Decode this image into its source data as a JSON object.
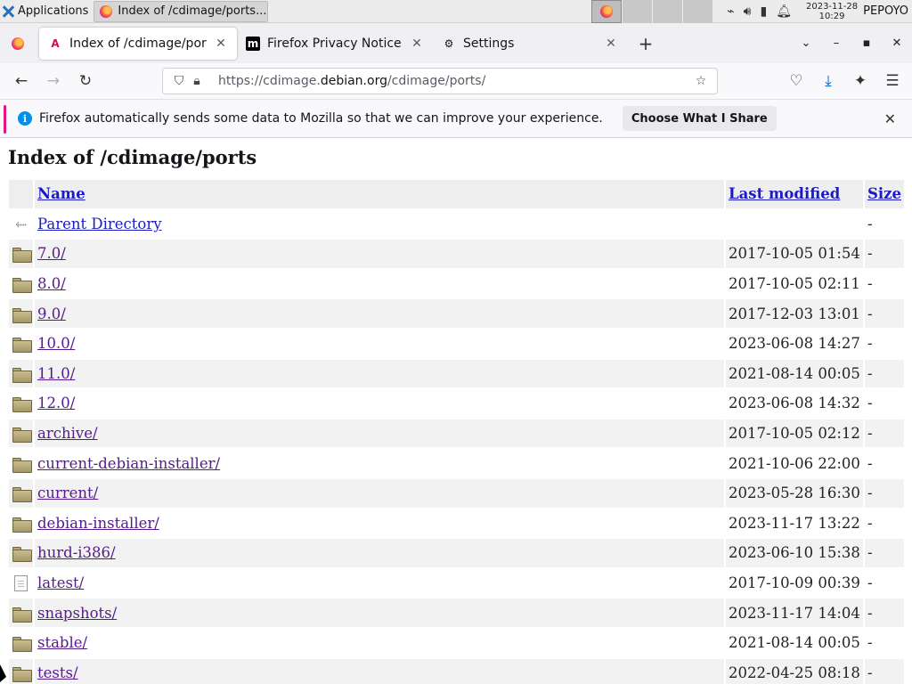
{
  "panel": {
    "apps_label": "Applications",
    "task_title": "Index of /cdimage/ports...",
    "clock_date": "2023-11-28",
    "clock_time": "10:29",
    "user": "PEPOYO"
  },
  "tabs": [
    {
      "title": "Index of /cdimage/ports",
      "icon": "debian-icon",
      "selected": true
    },
    {
      "title": "Firefox Privacy Notice —",
      "icon": "mozilla-icon",
      "selected": false
    },
    {
      "title": "Settings",
      "icon": "gear-icon",
      "selected": false
    }
  ],
  "navbar": {
    "url_prefix": "https://cdimage.",
    "url_domain": "debian.org",
    "url_path": "/cdimage/ports/"
  },
  "notice": {
    "message": "Firefox automatically sends some data to Mozilla so that we can improve your experience.",
    "button": "Choose What I Share"
  },
  "page": {
    "title": "Index of /cdimage/ports",
    "columns": {
      "name": "Name",
      "modified": "Last modified",
      "size": "Size"
    },
    "parent": {
      "name": "Parent Directory",
      "size": "-"
    },
    "rows": [
      {
        "name": "7.0/",
        "modified": "2017-10-05 01:54",
        "size": "-",
        "type": "folder"
      },
      {
        "name": "8.0/",
        "modified": "2017-10-05 02:11",
        "size": "-",
        "type": "folder"
      },
      {
        "name": "9.0/",
        "modified": "2017-12-03 13:01",
        "size": "-",
        "type": "folder"
      },
      {
        "name": "10.0/",
        "modified": "2023-06-08 14:27",
        "size": "-",
        "type": "folder"
      },
      {
        "name": "11.0/",
        "modified": "2021-08-14 00:05",
        "size": "-",
        "type": "folder"
      },
      {
        "name": "12.0/",
        "modified": "2023-06-08 14:32",
        "size": "-",
        "type": "folder"
      },
      {
        "name": "archive/",
        "modified": "2017-10-05 02:12",
        "size": "-",
        "type": "folder"
      },
      {
        "name": "current-debian-installer/",
        "modified": "2021-10-06 22:00",
        "size": "-",
        "type": "folder"
      },
      {
        "name": "current/",
        "modified": "2023-05-28 16:30",
        "size": "-",
        "type": "folder"
      },
      {
        "name": "debian-installer/",
        "modified": "2023-11-17 13:22",
        "size": "-",
        "type": "folder"
      },
      {
        "name": "hurd-i386/",
        "modified": "2023-06-10 15:38",
        "size": "-",
        "type": "folder"
      },
      {
        "name": "latest/",
        "modified": "2017-10-09 00:39",
        "size": "-",
        "type": "file"
      },
      {
        "name": "snapshots/",
        "modified": "2023-11-17 14:04",
        "size": "-",
        "type": "folder"
      },
      {
        "name": "stable/",
        "modified": "2021-08-14 00:05",
        "size": "-",
        "type": "folder"
      },
      {
        "name": "tests/",
        "modified": "2022-04-25 08:18",
        "size": "-",
        "type": "folder"
      }
    ]
  }
}
